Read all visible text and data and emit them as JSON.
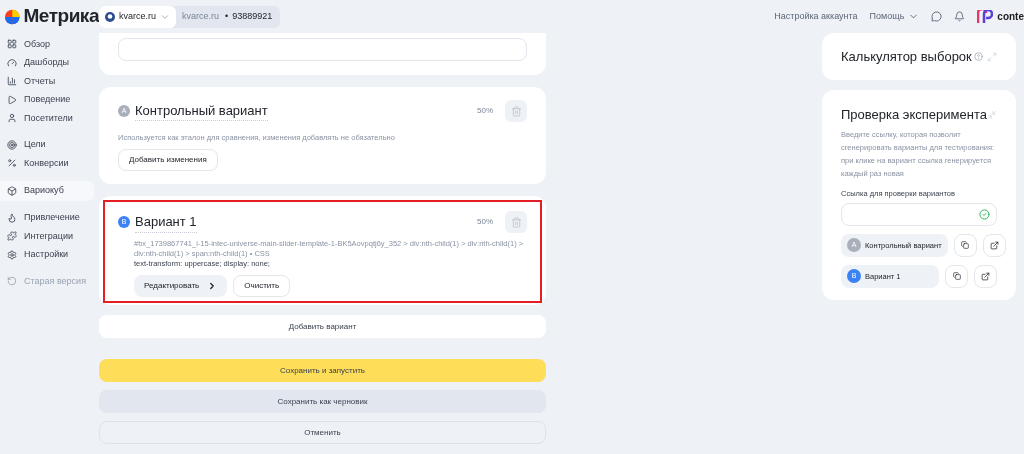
{
  "header": {
    "logo": "Метрика",
    "counter": {
      "site": "kvarce.ru",
      "caption": "kvarce.ru",
      "separator": "•",
      "id": "93889921"
    },
    "links": [
      {
        "label": "Настройка аккаунта",
        "kind": "link"
      },
      {
        "label": "Помощь",
        "kind": "dropdown"
      }
    ],
    "account": "conte"
  },
  "sidebar": {
    "items": [
      {
        "label": "Обзор",
        "selected": false,
        "disabled": false
      },
      {
        "label": "Дашборды",
        "selected": false,
        "disabled": false
      },
      {
        "label": "Отчеты",
        "selected": false,
        "disabled": false
      },
      {
        "label": "Поведение",
        "selected": false,
        "disabled": false
      },
      {
        "label": "Посетители",
        "selected": false,
        "disabled": false
      },
      {
        "label": "Цели",
        "selected": false,
        "disabled": false
      },
      {
        "label": "Конверсии",
        "selected": false,
        "disabled": false
      },
      {
        "label": "Вариокуб",
        "selected": true,
        "disabled": false
      },
      {
        "label": "Привлечение",
        "selected": false,
        "disabled": false
      },
      {
        "label": "Интеграции",
        "selected": false,
        "disabled": false
      },
      {
        "label": "Настройки",
        "selected": false,
        "disabled": false
      },
      {
        "label": "Старая версия",
        "selected": false,
        "disabled": true
      }
    ]
  },
  "variants": [
    {
      "letter": "A",
      "color": "#a9b0bc",
      "name": "Контрольный вариант",
      "share": "50%",
      "highlighted": false,
      "description": "Используется как эталон для сравнения, изменения добавлять не обязательно",
      "buttons": [
        {
          "label": "Добавить изменения",
          "kind": "outline"
        }
      ]
    },
    {
      "letter": "B",
      "color": "#3b82f6",
      "name": "Вариант 1",
      "share": "50%",
      "highlighted": true,
      "selector": "#bx_1739867741_i-15-intec-universe-main-slider-template-1-BK5Aovpqtj6y_352 > div:nth-child(1) > div:nth-child(1) > div:nth-child(1) > span:nth-child(1) • CSS",
      "css": "text-transform: uppercase; display: none;",
      "buttons": [
        {
          "label": "Редактировать",
          "kind": "filled"
        },
        {
          "label": "Очистить",
          "kind": "outline"
        }
      ]
    }
  ],
  "add_variant": "Добавить вариант",
  "actions": [
    {
      "label": "Сохранить и запустить",
      "kind": "primary"
    },
    {
      "label": "Сохранить как черновик",
      "kind": "secondary"
    },
    {
      "label": "Отменить",
      "kind": "outline"
    }
  ],
  "calculator": {
    "title": "Калькулятор выборок"
  },
  "check": {
    "title": "Проверка эксперимента",
    "description": "Введите ссылку, которая позволит сгенерировать варианты для тестирования: при клике на вариант ссылка генерируется каждый раз новая",
    "field_label": "Ссылка для проверки вариантов",
    "valid": true,
    "variants": [
      {
        "letter": "A",
        "color": "#a9b0bc",
        "name": "Контрольный вариант"
      },
      {
        "letter": "B",
        "color": "#3b82f6",
        "name": "Вариант 1"
      }
    ]
  }
}
